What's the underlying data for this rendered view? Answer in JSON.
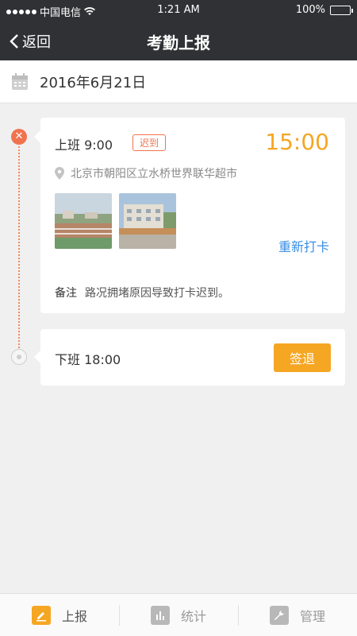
{
  "status_bar": {
    "carrier": "中国电信",
    "time": "1:21 AM",
    "battery": "100%"
  },
  "nav": {
    "back_label": "返回",
    "title": "考勤上报"
  },
  "date": "2016年6月21日",
  "checkin": {
    "label": "上班 9:00",
    "badge": "迟到",
    "actual_time": "15:00",
    "location": "北京市朝阳区立水桥世界联华超市",
    "redo_label": "重新打卡",
    "remark_label": "备注",
    "remark_text": "路况拥堵原因导致打卡迟到。",
    "photos": [
      "photo-playground",
      "photo-building"
    ]
  },
  "checkout": {
    "label": "下班 18:00",
    "button_label": "签退"
  },
  "tabs": [
    {
      "label": "上报",
      "icon": "pencil-icon",
      "active": true
    },
    {
      "label": "统计",
      "icon": "bar-chart-icon",
      "active": false
    },
    {
      "label": "管理",
      "icon": "wrench-icon",
      "active": false
    }
  ],
  "colors": {
    "accent": "#f5a623",
    "late": "#f0734f",
    "link": "#3a8ee6",
    "nav_bg": "#2f3134"
  }
}
